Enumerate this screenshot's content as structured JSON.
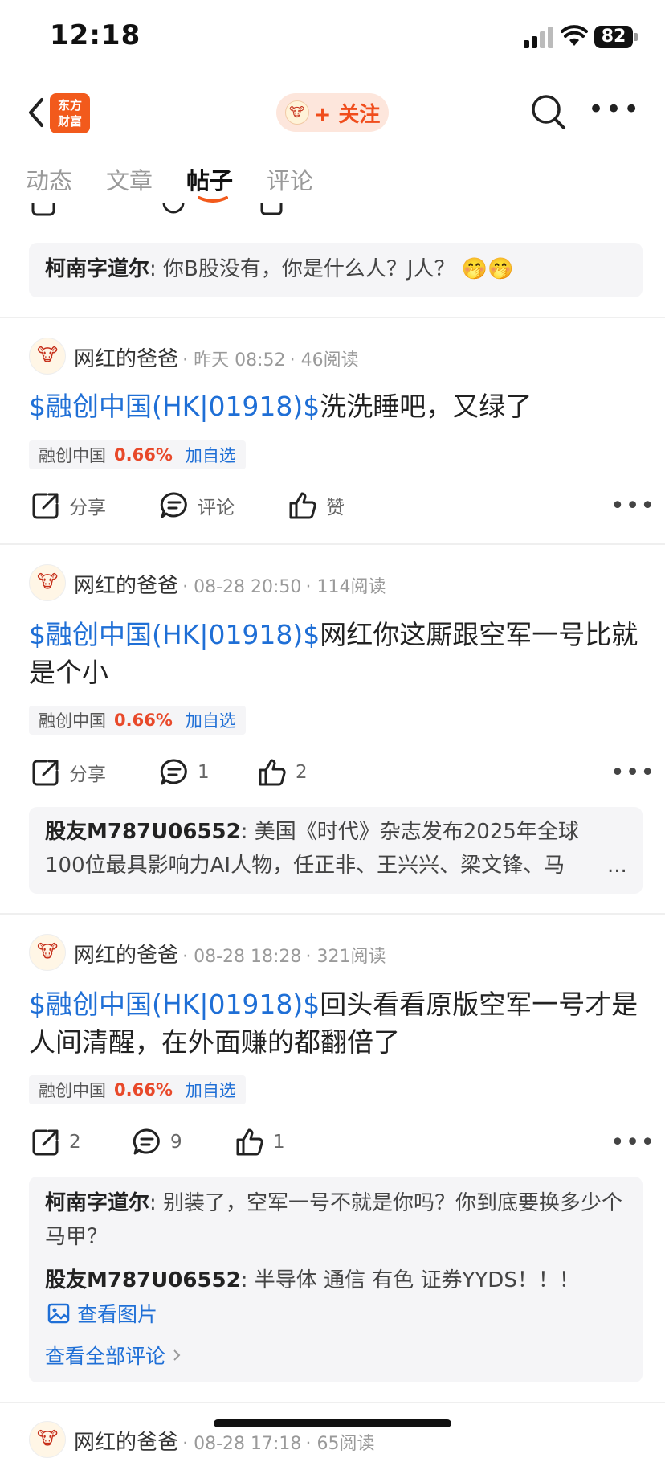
{
  "status": {
    "time": "12:18",
    "battery": "82"
  },
  "nav": {
    "logo_line1": "东方",
    "logo_line2": "财富",
    "follow_label": "+ 关注"
  },
  "tabs": [
    {
      "label": "动态",
      "active": false
    },
    {
      "label": "文章",
      "active": false
    },
    {
      "label": "帖子",
      "active": true
    },
    {
      "label": "评论",
      "active": false
    }
  ],
  "top_comment": {
    "name": "柯南字道尔",
    "sep": ":",
    "text": "你B股没有，你是什么人？J人？",
    "emoji": "🤭🤭"
  },
  "posts": [
    {
      "author": "网红的爸爸",
      "time": "昨天 08:52",
      "reads": "46阅读",
      "stock_tag": "$融创中国(HK|01918)$",
      "text": "洗洗睡吧，又绿了",
      "chip": {
        "name": "融创中国",
        "pct": "0.66%",
        "add": "加自选"
      },
      "actions": {
        "share": "分享",
        "comment": "评论",
        "like": "赞"
      }
    },
    {
      "author": "网红的爸爸",
      "time": "08-28 20:50",
      "reads": "114阅读",
      "stock_tag": "$融创中国(HK|01918)$",
      "text": "网红你这厮跟空军一号比就是个小",
      "chip": {
        "name": "融创中国",
        "pct": "0.66%",
        "add": "加自选"
      },
      "actions": {
        "share": "分享",
        "comment": "1",
        "like": "2"
      },
      "comment": {
        "name": "股友M787U06552",
        "sep": ":",
        "text": "美国《时代》杂志发布2025年全球100位最具影响力AI人物，任正非、王兴兴、梁文锋、马",
        "more": "..."
      }
    },
    {
      "author": "网红的爸爸",
      "time": "08-28 18:28",
      "reads": "321阅读",
      "stock_tag": "$融创中国(HK|01918)$",
      "text": "回头看看原版空军一号才是人间清醒，在外面赚的都翻倍了",
      "chip": {
        "name": "融创中国",
        "pct": "0.66%",
        "add": "加自选"
      },
      "actions": {
        "share": "2",
        "comment": "9",
        "like": "1"
      },
      "comments": [
        {
          "name": "柯南字道尔",
          "sep": ":",
          "text": "别装了，空军一号不就是你吗？你到底要换多少个马甲？"
        },
        {
          "name": "股友M787U06552",
          "sep": ":",
          "text": "半导体 通信 有色 证券YYDS！！！",
          "image_link": "查看图片"
        }
      ],
      "view_all": "查看全部评论"
    },
    {
      "author": "网红的爸爸",
      "time": "08-28 17:18",
      "reads": "65阅读"
    }
  ],
  "colors": {
    "accent": "#f25a1c",
    "link": "#1f6fd6",
    "up": "#e8492a"
  }
}
